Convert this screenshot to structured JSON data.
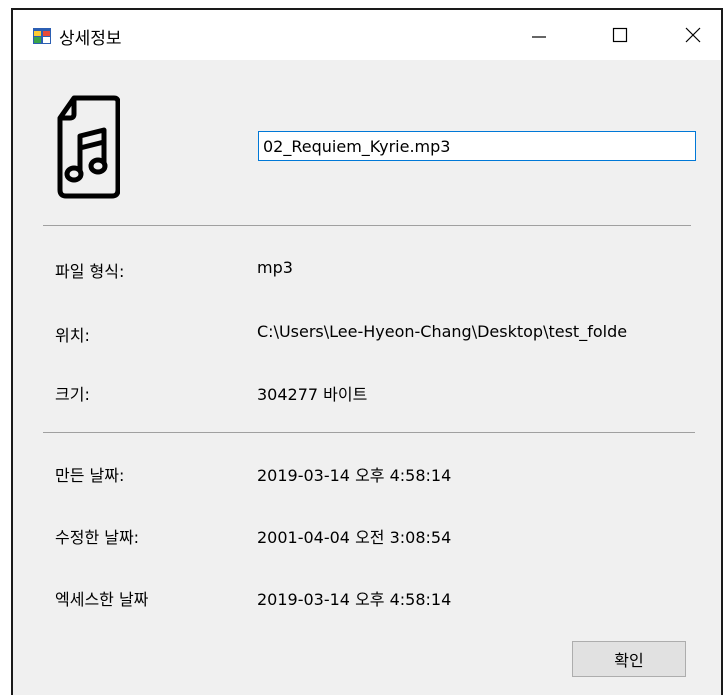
{
  "window": {
    "title": "상세정보"
  },
  "titlebar_buttons": {
    "minimize": "minimize-icon",
    "maximize": "maximize-icon",
    "close": "close-icon"
  },
  "file": {
    "icon": "music-file-icon",
    "name": "02_Requiem_Kyrie.mp3"
  },
  "details": [
    {
      "label": "파일 형식:",
      "value": "mp3"
    },
    {
      "label": "위치:",
      "value": "C:\\Users\\Lee-Hyeon-Chang\\Desktop\\test_folde"
    },
    {
      "label": "크기:",
      "value": "304277 바이트"
    }
  ],
  "dates": [
    {
      "label": "만든 날짜:",
      "value": "2019-03-14 오후 4:58:14"
    },
    {
      "label": "수정한 날짜:",
      "value": "2001-04-04 오전 3:08:54"
    },
    {
      "label": "엑세스한 날짜",
      "value": "2019-03-14 오후 4:58:14"
    }
  ],
  "buttons": {
    "ok": "확인"
  }
}
